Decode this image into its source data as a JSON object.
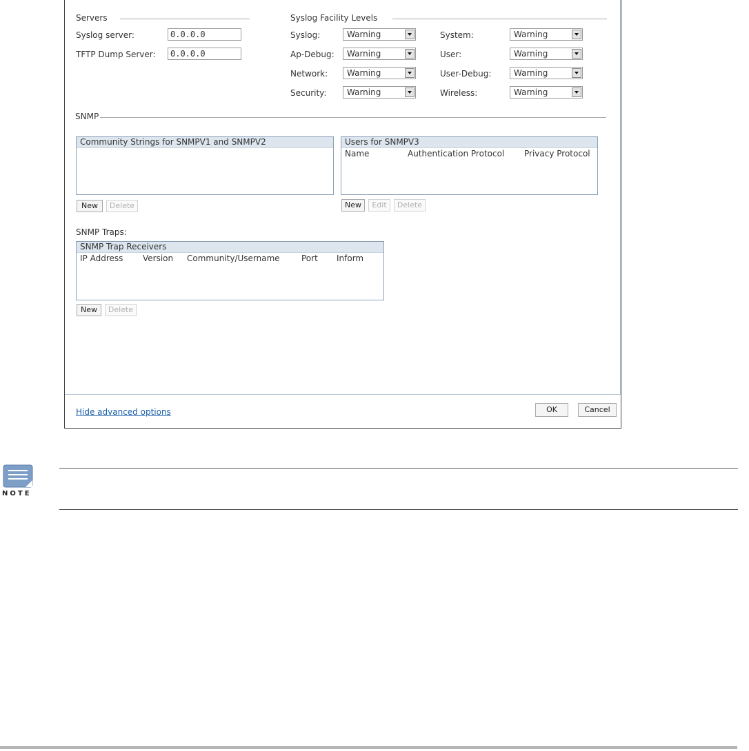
{
  "servers": {
    "section_label": "Servers",
    "syslog_label": "Syslog server:",
    "syslog_value": "0.0.0.0",
    "tftp_label": "TFTP Dump Server:",
    "tftp_value": "0.0.0.0"
  },
  "facility": {
    "section_label": "Syslog Facility Levels",
    "levels": [
      {
        "label": "Syslog:",
        "value": "Warning"
      },
      {
        "label": "Ap-Debug:",
        "value": "Warning"
      },
      {
        "label": "Network:",
        "value": "Warning"
      },
      {
        "label": "Security:",
        "value": "Warning"
      },
      {
        "label": "System:",
        "value": "Warning"
      },
      {
        "label": "User:",
        "value": "Warning"
      },
      {
        "label": "User-Debug:",
        "value": "Warning"
      },
      {
        "label": "Wireless:",
        "value": "Warning"
      }
    ]
  },
  "snmp": {
    "section_label": "SNMP",
    "community_title": "Community Strings for SNMPV1 and SNMPV2",
    "users_title": "Users for SNMPV3",
    "users_columns": [
      "Name",
      "Authentication Protocol",
      "Privacy Protocol"
    ],
    "new_label": "New",
    "edit_label": "Edit",
    "delete_label": "Delete"
  },
  "traps": {
    "label": "SNMP Traps:",
    "title": "SNMP Trap Receivers",
    "columns": [
      "IP Address",
      "Version",
      "Community/Username",
      "Port",
      "Inform"
    ],
    "new_label": "New",
    "delete_label": "Delete"
  },
  "footer": {
    "advanced_link": "Hide advanced options",
    "ok_label": "OK",
    "cancel_label": "Cancel"
  },
  "note": {
    "icon_text": "NOTE"
  }
}
